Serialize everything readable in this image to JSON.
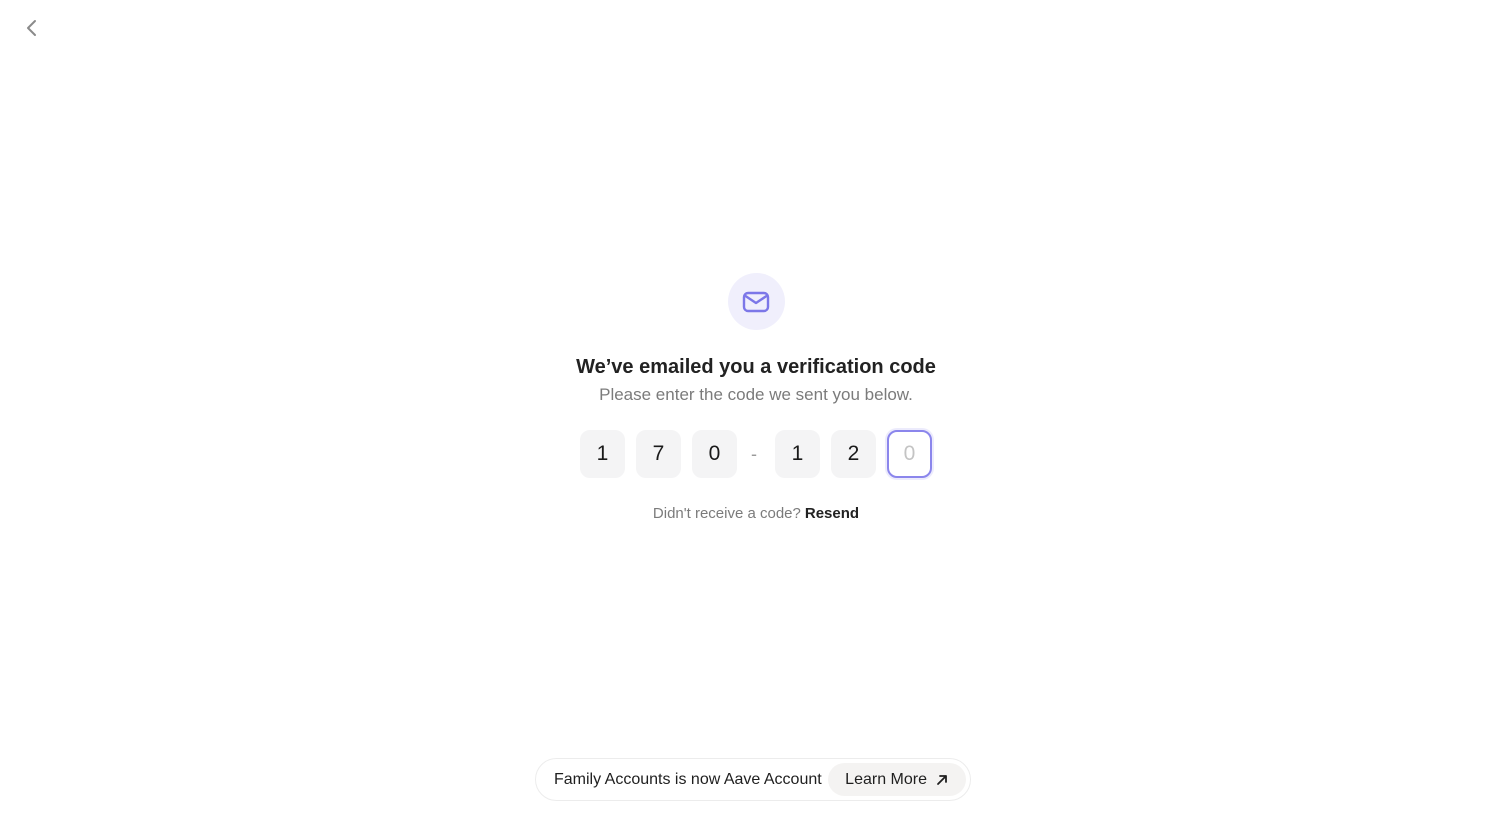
{
  "nav": {
    "back_icon": "chevron-left-icon"
  },
  "header": {
    "icon": "mail-icon",
    "title": "We’ve emailed you a verification code",
    "subtitle": "Please enter the code we sent you below."
  },
  "code": {
    "digits": [
      "1",
      "7",
      "0",
      "1",
      "2"
    ],
    "separator": "-",
    "active_placeholder": "0",
    "accent_color": "#8b86ec"
  },
  "resend": {
    "prompt": "Didn't receive a code?",
    "link_label": "Resend"
  },
  "banner": {
    "text": "Family Accounts is now Aave Account",
    "button_label": "Learn More",
    "button_icon": "arrow-up-right-icon"
  }
}
